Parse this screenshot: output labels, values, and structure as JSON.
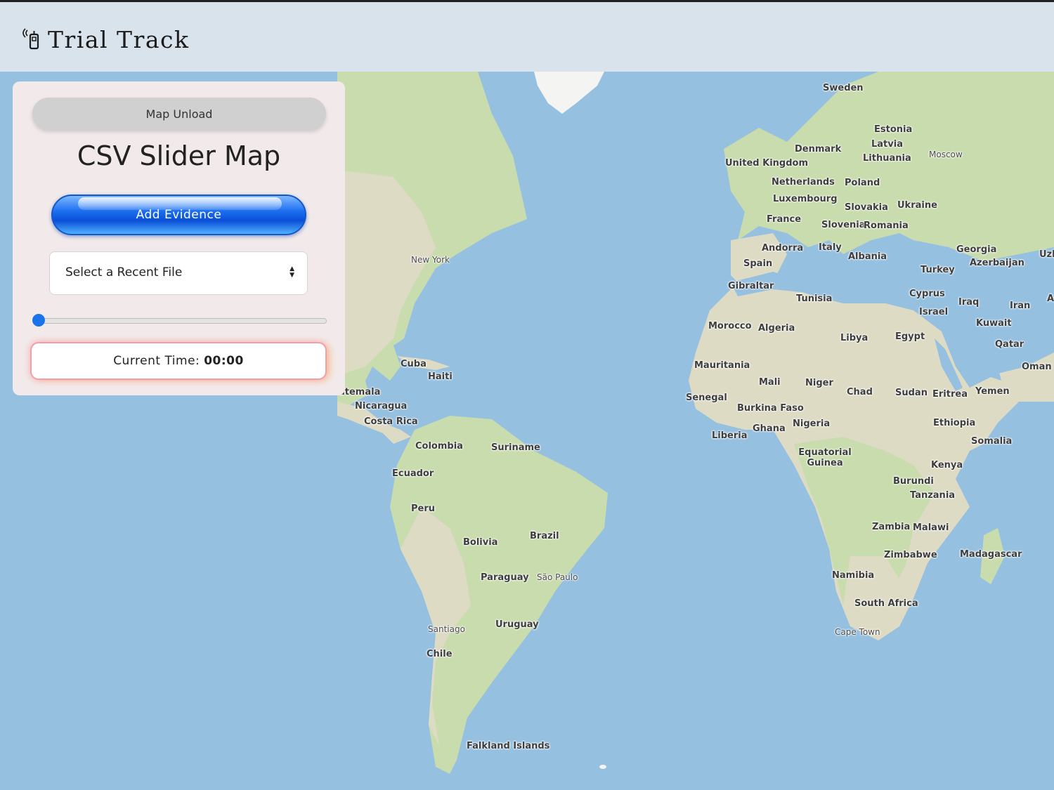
{
  "header": {
    "title": "Trial Track",
    "icon": "phone-signal-icon"
  },
  "panel": {
    "unload_label": "Map Unload",
    "title": "CSV Slider Map",
    "add_label": "Add Evidence",
    "select": {
      "value": "Select a Recent File"
    },
    "slider": {
      "value": 0
    },
    "time": {
      "label": "Current Time:",
      "value": "00:00"
    }
  },
  "map": {
    "countries": [
      "Sweden",
      "Estonia",
      "Latvia",
      "Lithuania",
      "Denmark",
      "United Kingdom",
      "Netherlands",
      "Poland",
      "Luxembourg",
      "Slovakia",
      "Ukraine",
      "France",
      "Slovenia",
      "Romania",
      "Andorra",
      "Italy",
      "Spain",
      "Albania",
      "Georgia",
      "Azerbaijan",
      "Turkey",
      "Gibraltar",
      "Cyprus",
      "Tunisia",
      "Iraq",
      "Iran",
      "Israel",
      "Kuwait",
      "Morocco",
      "Algeria",
      "Libya",
      "Egypt",
      "Qatar",
      "Oman",
      "Mauritania",
      "Mali",
      "Niger",
      "Chad",
      "Sudan",
      "Eritrea",
      "Yemen",
      "Senegal",
      "Burkina Faso",
      "Ghana",
      "Nigeria",
      "Liberia",
      "Ethiopia",
      "Somalia",
      "Equatorial Guinea",
      "Kenya",
      "Burundi",
      "Tanzania",
      "Zambia",
      "Malawi",
      "Zimbabwe",
      "Madagascar",
      "Namibia",
      "South Africa",
      "Cuba",
      "Haiti",
      "atemala",
      "Nicaragua",
      "Costa Rica",
      "Colombia",
      "Suriname",
      "Ecuador",
      "Peru",
      "Brazil",
      "Bolivia",
      "Paraguay",
      "Uruguay",
      "Chile",
      "Falkland Islands",
      "Uzb",
      "A"
    ],
    "cities": [
      "Moscow",
      "New York",
      "São Paulo",
      "Santiago",
      "Cape Town"
    ]
  }
}
